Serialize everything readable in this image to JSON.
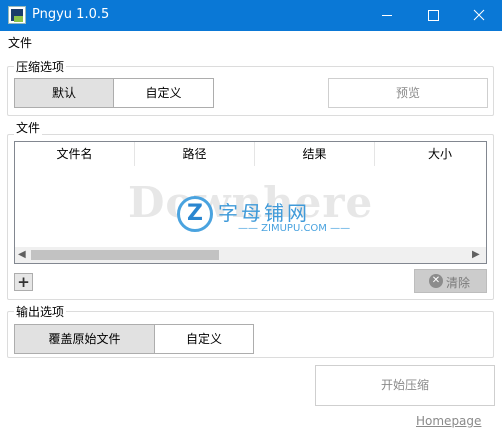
{
  "window": {
    "title": "Pngyu 1.0.5",
    "minimize_icon": "minimize-icon",
    "maximize_icon": "maximize-icon",
    "close_icon": "close-icon"
  },
  "menu": {
    "file": "文件"
  },
  "compression": {
    "group_title": "压缩选项",
    "default_label": "默认",
    "custom_label": "自定义",
    "preview_label": "预览"
  },
  "files": {
    "group_title": "文件",
    "columns": [
      "文件名",
      "路径",
      "结果",
      "大小"
    ],
    "add_label": "+",
    "clear_label": "清除"
  },
  "watermark": {
    "text": "Downhere",
    "cn": "字母铺网",
    "url": "—— ZIMUPU.COM ——"
  },
  "output": {
    "group_title": "输出选项",
    "overwrite_label": "覆盖原始文件",
    "custom_label": "自定义"
  },
  "actions": {
    "start_label": "开始压缩",
    "homepage_label": "Homepage"
  },
  "colors": {
    "titlebar": "#0a78d6",
    "segment_active": "#e1e1e1",
    "disabled_text": "#8a8a8a"
  }
}
